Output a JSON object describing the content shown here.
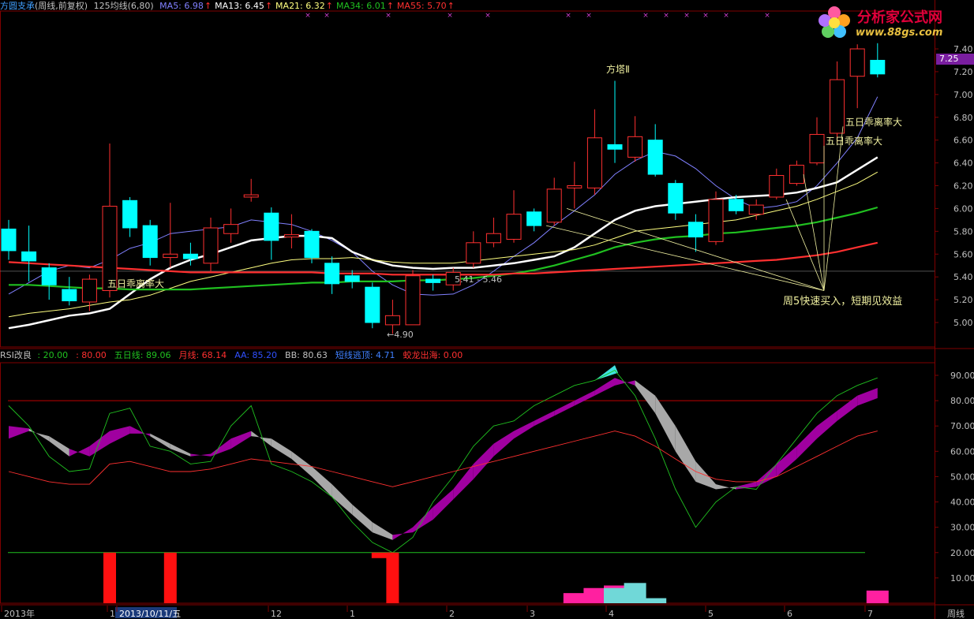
{
  "upper": {
    "indicator_name": "方圆支承",
    "params": "(周线,前复权)",
    "ma125": "125均线(6,80)",
    "mas": [
      {
        "label": "MA5: 6.98",
        "color": "#8080ff"
      },
      {
        "label": "MA13: 6.45",
        "color": "#ffffff"
      },
      {
        "label": "MA21: 6.32",
        "color": "#ffff80"
      },
      {
        "label": "MA34: 6.01",
        "color": "#20c020"
      },
      {
        "label": "MA55: 5.70",
        "color": "#ff3030"
      }
    ],
    "arrow": "↑",
    "current_price": "7.25",
    "y_ticks": [
      "7.40",
      "7.20",
      "7.00",
      "6.80",
      "6.60",
      "6.40",
      "6.20",
      "6.00",
      "5.80",
      "5.60",
      "5.40",
      "5.20",
      "5.00"
    ],
    "annotations": {
      "tower": "方塔Ⅱ",
      "bias1": "五日乖离率大",
      "bias2": "五日乖离率大",
      "bias3": "五日乖离率大",
      "buy": "周5快速买入，短期见效益",
      "low": "←4.90",
      "range": "5.41 - 5.46"
    }
  },
  "lower": {
    "indicator_name": "RSI改良",
    "items": [
      {
        "label": ": 20.00",
        "color": "#20c020"
      },
      {
        "label": ": 80.00",
        "color": "#ff3030"
      },
      {
        "label": "五日线: 89.06",
        "color": "#20c020"
      },
      {
        "label": "月线: 68.14",
        "color": "#ff3030"
      },
      {
        "label": "AA: 85.20",
        "color": "#3050ff"
      },
      {
        "label": "BB: 80.63",
        "color": "#c0c0c0"
      },
      {
        "label": "短线逃顶: 4.71",
        "color": "#4080ff"
      },
      {
        "label": "蛟龙出海: 0.00",
        "color": "#ff3030"
      }
    ],
    "y_ticks": [
      "90.00",
      "80.00",
      "70.00",
      "60.00",
      "50.00",
      "40.00",
      "30.00",
      "20.00",
      "10.00"
    ]
  },
  "x_axis": {
    "labels": [
      "2013年",
      "1",
      "2013/10/11/五",
      "12",
      "1",
      "2",
      "3",
      "4",
      "5",
      "6",
      "7"
    ],
    "period": "周线"
  },
  "logo": {
    "title": "分析家公式网",
    "url": "www.88gs.com"
  },
  "chart_data": [
    {
      "type": "candlestick",
      "title": "方圆支承",
      "ylim": [
        4.85,
        7.45
      ],
      "candles": [
        {
          "o": 5.82,
          "c": 5.63,
          "h": 5.9,
          "l": 5.55
        },
        {
          "o": 5.62,
          "c": 5.54,
          "h": 5.85,
          "l": 5.36
        },
        {
          "o": 5.48,
          "c": 5.33,
          "h": 5.52,
          "l": 5.2
        },
        {
          "o": 5.29,
          "c": 5.19,
          "h": 5.4,
          "l": 5.15
        },
        {
          "o": 5.18,
          "c": 5.38,
          "h": 5.42,
          "l": 5.1
        },
        {
          "o": 5.28,
          "c": 6.02,
          "h": 6.57,
          "l": 5.22
        },
        {
          "o": 6.07,
          "c": 5.83,
          "h": 6.1,
          "l": 5.75
        },
        {
          "o": 5.85,
          "c": 5.57,
          "h": 5.9,
          "l": 5.5
        },
        {
          "o": 5.57,
          "c": 5.6,
          "h": 6.05,
          "l": 5.48
        },
        {
          "o": 5.6,
          "c": 5.56,
          "h": 5.7,
          "l": 5.5
        },
        {
          "o": 5.52,
          "c": 5.83,
          "h": 5.92,
          "l": 5.45
        },
        {
          "o": 5.78,
          "c": 5.86,
          "h": 6.0,
          "l": 5.7
        },
        {
          "o": 6.1,
          "c": 6.12,
          "h": 6.26,
          "l": 6.06
        },
        {
          "o": 5.96,
          "c": 5.72,
          "h": 6.01,
          "l": 5.55
        },
        {
          "o": 5.75,
          "c": 5.77,
          "h": 5.95,
          "l": 5.65
        },
        {
          "o": 5.8,
          "c": 5.57,
          "h": 5.82,
          "l": 5.52
        },
        {
          "o": 5.52,
          "c": 5.34,
          "h": 5.58,
          "l": 5.25
        },
        {
          "o": 5.41,
          "c": 5.36,
          "h": 5.46,
          "l": 5.3
        },
        {
          "o": 5.31,
          "c": 5.0,
          "h": 5.35,
          "l": 4.95
        },
        {
          "o": 4.98,
          "c": 5.06,
          "h": 5.2,
          "l": 4.9
        },
        {
          "o": 4.98,
          "c": 5.41,
          "h": 5.46,
          "l": 4.98
        },
        {
          "o": 5.38,
          "c": 5.35,
          "h": 5.42,
          "l": 5.28
        },
        {
          "o": 5.33,
          "c": 5.44,
          "h": 5.48,
          "l": 5.28
        },
        {
          "o": 5.52,
          "c": 5.7,
          "h": 5.8,
          "l": 5.48
        },
        {
          "o": 5.7,
          "c": 5.78,
          "h": 5.92,
          "l": 5.66
        },
        {
          "o": 5.73,
          "c": 5.95,
          "h": 6.16,
          "l": 5.7
        },
        {
          "o": 5.97,
          "c": 5.85,
          "h": 6.0,
          "l": 5.8
        },
        {
          "o": 5.88,
          "c": 6.17,
          "h": 6.27,
          "l": 5.85
        },
        {
          "o": 6.18,
          "c": 6.2,
          "h": 6.41,
          "l": 6.0
        },
        {
          "o": 6.18,
          "c": 6.62,
          "h": 6.87,
          "l": 6.12
        },
        {
          "o": 6.56,
          "c": 6.52,
          "h": 7.12,
          "l": 6.4
        },
        {
          "o": 6.45,
          "c": 6.63,
          "h": 6.81,
          "l": 6.41
        },
        {
          "o": 6.6,
          "c": 6.3,
          "h": 6.74,
          "l": 6.28
        },
        {
          "o": 6.22,
          "c": 5.96,
          "h": 6.25,
          "l": 5.9
        },
        {
          "o": 5.88,
          "c": 5.75,
          "h": 5.95,
          "l": 5.62
        },
        {
          "o": 5.71,
          "c": 6.08,
          "h": 6.15,
          "l": 5.68
        },
        {
          "o": 6.08,
          "c": 5.98,
          "h": 6.12,
          "l": 5.95
        },
        {
          "o": 5.95,
          "c": 6.03,
          "h": 6.08,
          "l": 5.9
        },
        {
          "o": 6.1,
          "c": 6.29,
          "h": 6.35,
          "l": 6.08
        },
        {
          "o": 6.22,
          "c": 6.38,
          "h": 6.42,
          "l": 6.2
        },
        {
          "o": 6.4,
          "c": 6.65,
          "h": 6.8,
          "l": 6.38
        },
        {
          "o": 6.66,
          "c": 7.13,
          "h": 7.29,
          "l": 6.58
        },
        {
          "o": 7.16,
          "c": 7.4,
          "h": 7.44,
          "l": 6.88
        },
        {
          "o": 7.3,
          "c": 7.18,
          "h": 7.45,
          "l": 7.15
        }
      ],
      "ma_lines": [
        {
          "name": "MA5",
          "color": "#8080ff",
          "values": [
            5.25,
            5.35,
            5.45,
            5.5,
            5.48,
            5.55,
            5.65,
            5.7,
            5.78,
            5.8,
            5.82,
            5.84,
            5.9,
            5.88,
            5.86,
            5.8,
            5.72,
            5.62,
            5.45,
            5.33,
            5.25,
            5.24,
            5.25,
            5.33,
            5.45,
            5.58,
            5.7,
            5.85,
            5.98,
            6.12,
            6.3,
            6.42,
            6.5,
            6.46,
            6.35,
            6.2,
            6.08,
            6.0,
            6.02,
            6.06,
            6.2,
            6.4,
            6.62,
            6.98
          ]
        },
        {
          "name": "MA13",
          "color": "#ffffff",
          "values": [
            4.95,
            4.98,
            5.02,
            5.06,
            5.08,
            5.12,
            5.25,
            5.38,
            5.48,
            5.55,
            5.6,
            5.66,
            5.72,
            5.74,
            5.76,
            5.76,
            5.74,
            5.62,
            5.55,
            5.5,
            5.48,
            5.47,
            5.48,
            5.48,
            5.5,
            5.52,
            5.55,
            5.58,
            5.66,
            5.78,
            5.9,
            5.98,
            6.02,
            6.04,
            6.06,
            6.08,
            6.1,
            6.11,
            6.12,
            6.14,
            6.18,
            6.23,
            6.34,
            6.45
          ]
        },
        {
          "name": "MA21",
          "color": "#ffff80",
          "values": [
            5.05,
            5.08,
            5.1,
            5.12,
            5.15,
            5.18,
            5.2,
            5.24,
            5.3,
            5.36,
            5.4,
            5.44,
            5.48,
            5.52,
            5.55,
            5.56,
            5.56,
            5.57,
            5.55,
            5.53,
            5.52,
            5.52,
            5.52,
            5.54,
            5.56,
            5.58,
            5.6,
            5.62,
            5.64,
            5.68,
            5.74,
            5.8,
            5.82,
            5.84,
            5.86,
            5.88,
            5.9,
            5.94,
            5.98,
            6.02,
            6.08,
            6.15,
            6.22,
            6.32
          ]
        },
        {
          "name": "MA34",
          "color": "#20c020",
          "values": [
            5.33,
            5.33,
            5.32,
            5.31,
            5.3,
            5.3,
            5.29,
            5.29,
            5.29,
            5.29,
            5.3,
            5.31,
            5.32,
            5.33,
            5.34,
            5.35,
            5.35,
            5.36,
            5.36,
            5.36,
            5.37,
            5.37,
            5.38,
            5.39,
            5.41,
            5.43,
            5.46,
            5.5,
            5.55,
            5.6,
            5.66,
            5.7,
            5.73,
            5.75,
            5.76,
            5.78,
            5.79,
            5.81,
            5.83,
            5.85,
            5.88,
            5.92,
            5.96,
            6.01
          ]
        },
        {
          "name": "MA55",
          "color": "#ff3030",
          "values": [
            5.53,
            5.52,
            5.51,
            5.5,
            5.49,
            5.48,
            5.47,
            5.46,
            5.45,
            5.44,
            5.44,
            5.44,
            5.44,
            5.44,
            5.44,
            5.44,
            5.43,
            5.43,
            5.43,
            5.42,
            5.42,
            5.42,
            5.42,
            5.42,
            5.42,
            5.43,
            5.43,
            5.44,
            5.45,
            5.46,
            5.47,
            5.48,
            5.49,
            5.5,
            5.51,
            5.52,
            5.53,
            5.54,
            5.55,
            5.57,
            5.59,
            5.62,
            5.66,
            5.7
          ]
        }
      ],
      "hline": 5.45
    },
    {
      "type": "line",
      "title": "RSI改良",
      "ylim": [
        0,
        98
      ],
      "levels": [
        20,
        80
      ],
      "series": [
        {
          "name": "五日线",
          "color": "#20c020",
          "values": [
            78,
            70,
            58,
            52,
            53,
            75,
            77,
            62,
            60,
            55,
            56,
            70,
            78,
            55,
            52,
            48,
            42,
            32,
            24,
            20,
            26,
            40,
            50,
            62,
            70,
            72,
            78,
            82,
            86,
            88,
            92,
            82,
            65,
            45,
            30,
            40,
            46,
            45,
            55,
            65,
            75,
            82,
            86,
            89
          ]
        },
        {
          "name": "月线",
          "color": "#ff3030",
          "values": [
            52,
            50,
            48,
            47,
            47,
            55,
            56,
            54,
            52,
            52,
            53,
            55,
            57,
            56,
            55,
            54,
            52,
            50,
            48,
            46,
            48,
            50,
            52,
            54,
            56,
            58,
            60,
            62,
            64,
            66,
            68,
            66,
            62,
            57,
            52,
            49,
            48,
            48,
            50,
            54,
            58,
            62,
            66,
            68
          ]
        },
        {
          "name": "AA",
          "color": "#a000a0",
          "values": [
            70,
            69,
            64,
            58,
            62,
            68,
            70,
            66,
            61,
            58,
            59,
            65,
            68,
            62,
            57,
            50,
            42,
            35,
            28,
            25,
            30,
            38,
            45,
            55,
            63,
            68,
            72,
            76,
            80,
            84,
            89,
            86,
            75,
            60,
            48,
            45,
            46,
            48,
            55,
            62,
            70,
            76,
            82,
            85
          ]
        },
        {
          "name": "BB",
          "color": "#c0c0c0",
          "values": [
            65,
            68,
            66,
            61,
            58,
            63,
            67,
            67,
            63,
            59,
            58,
            61,
            66,
            65,
            60,
            54,
            47,
            39,
            32,
            27,
            28,
            33,
            41,
            49,
            58,
            65,
            70,
            74,
            78,
            82,
            86,
            88,
            82,
            70,
            56,
            47,
            45,
            46,
            50,
            57,
            65,
            72,
            78,
            81
          ]
        }
      ],
      "bars_red": [
        0,
        0,
        0,
        0,
        0,
        20,
        0,
        0,
        20,
        0,
        0,
        0,
        0,
        0,
        0,
        0,
        0,
        0,
        0,
        20,
        0,
        0,
        0,
        0,
        0,
        0,
        0,
        0,
        0,
        0,
        0,
        0,
        0,
        0,
        0,
        0,
        0,
        0,
        0,
        0,
        0,
        0,
        0,
        0
      ],
      "bars_magenta": [
        0,
        0,
        0,
        0,
        0,
        0,
        0,
        0,
        0,
        0,
        0,
        0,
        0,
        0,
        0,
        0,
        0,
        0,
        0,
        0,
        0,
        0,
        0,
        0,
        0,
        0,
        0,
        0,
        4,
        6,
        7,
        0,
        0,
        0,
        0,
        0,
        0,
        0,
        0,
        0,
        0,
        0,
        0,
        5
      ],
      "bars_cyan": [
        0,
        0,
        0,
        0,
        0,
        0,
        0,
        0,
        0,
        0,
        0,
        0,
        0,
        0,
        0,
        0,
        0,
        0,
        0,
        0,
        0,
        0,
        0,
        0,
        0,
        0,
        0,
        0,
        0,
        0,
        6,
        8,
        2,
        0,
        0,
        0,
        0,
        0,
        0,
        0,
        0,
        0,
        0,
        0
      ]
    }
  ]
}
